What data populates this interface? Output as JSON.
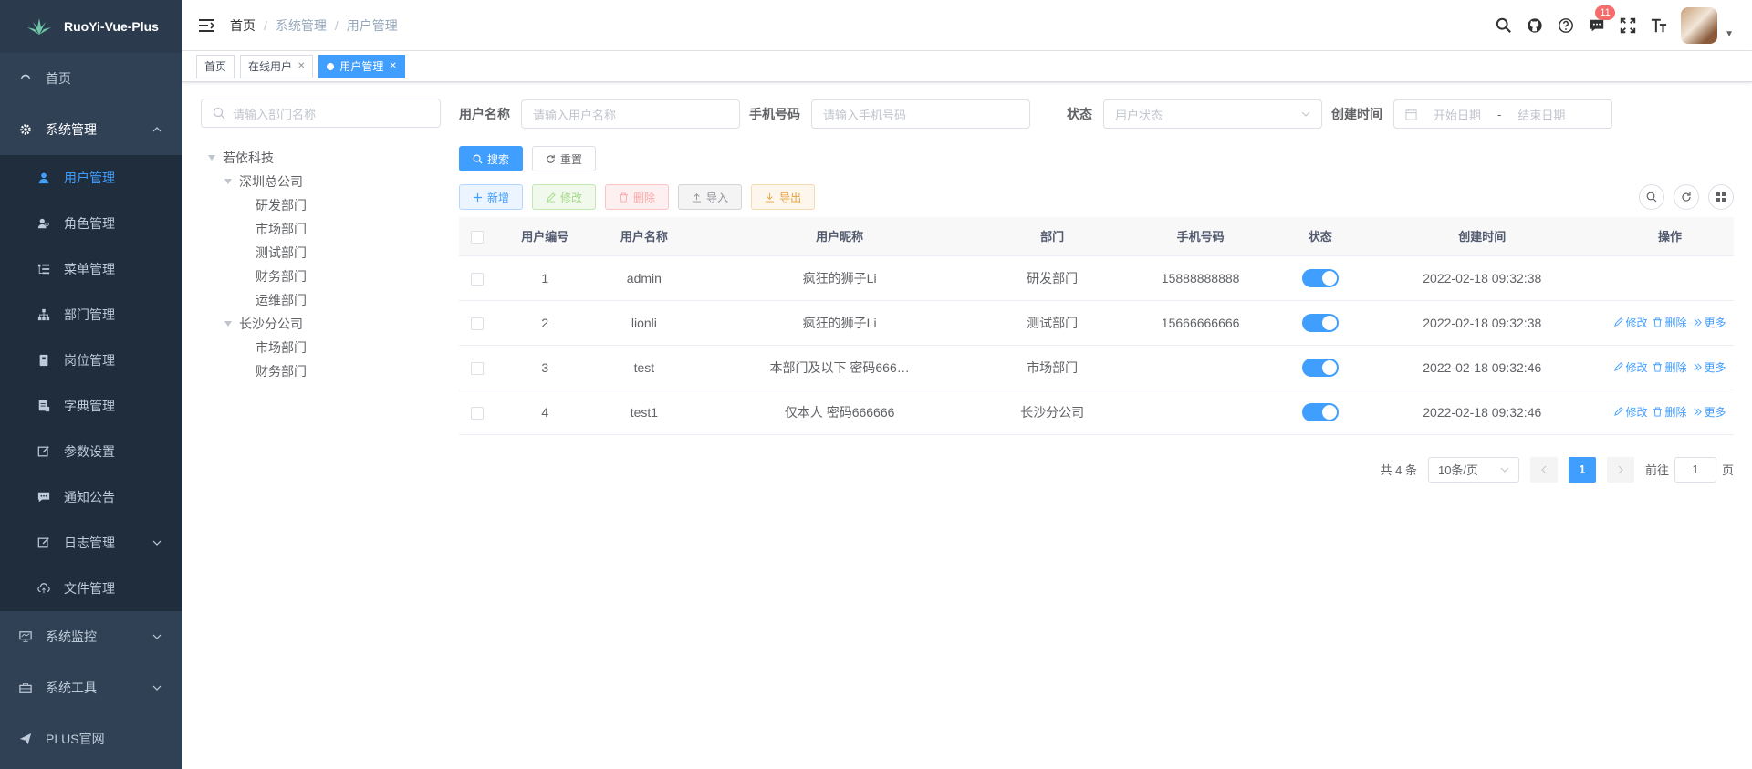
{
  "app": {
    "title": "RuoYi-Vue-Plus",
    "accent": "#409eff",
    "sidebar_bg": "#304156"
  },
  "sidebar": {
    "items": [
      {
        "label": "首页",
        "icon": "dashboard-icon"
      },
      {
        "label": "系统管理",
        "icon": "gear-icon",
        "expanded": true
      },
      {
        "label": "系统监控",
        "icon": "monitor-icon"
      },
      {
        "label": "系统工具",
        "icon": "toolbox-icon"
      },
      {
        "label": "PLUS官网",
        "icon": "send-icon"
      }
    ],
    "sub": [
      {
        "label": "用户管理",
        "icon": "user-icon",
        "active": true
      },
      {
        "label": "角色管理",
        "icon": "role-icon"
      },
      {
        "label": "菜单管理",
        "icon": "tree-table-icon"
      },
      {
        "label": "部门管理",
        "icon": "org-tree-icon"
      },
      {
        "label": "岗位管理",
        "icon": "post-icon"
      },
      {
        "label": "字典管理",
        "icon": "dict-icon"
      },
      {
        "label": "参数设置",
        "icon": "edit-icon"
      },
      {
        "label": "通知公告",
        "icon": "message-icon"
      },
      {
        "label": "日志管理",
        "icon": "log-icon"
      },
      {
        "label": "文件管理",
        "icon": "upload-icon"
      }
    ]
  },
  "navbar": {
    "breadcrumb": [
      "首页",
      "系统管理",
      "用户管理"
    ],
    "notice_count": "11",
    "icons": [
      "search-icon",
      "github-icon",
      "question-icon",
      "message-icon",
      "fullscreen-icon",
      "font-size-icon"
    ]
  },
  "tags": [
    {
      "label": "首页",
      "active": false,
      "closable": false
    },
    {
      "label": "在线用户",
      "active": false,
      "closable": true
    },
    {
      "label": "用户管理",
      "active": true,
      "closable": true
    }
  ],
  "dept_tree": {
    "placeholder": "请输入部门名称",
    "root": "若依科技",
    "branches": [
      {
        "label": "深圳总公司",
        "children": [
          "研发部门",
          "市场部门",
          "测试部门",
          "财务部门",
          "运维部门"
        ]
      },
      {
        "label": "长沙分公司",
        "children": [
          "市场部门",
          "财务部门"
        ]
      }
    ]
  },
  "search_form": {
    "username_label": "用户名称",
    "username_placeholder": "请输入用户名称",
    "phone_label": "手机号码",
    "phone_placeholder": "请输入手机号码",
    "status_label": "状态",
    "status_placeholder": "用户状态",
    "created_label": "创建时间",
    "start_placeholder": "开始日期",
    "range_sep": "-",
    "end_placeholder": "结束日期",
    "search_btn": "搜索",
    "reset_btn": "重置"
  },
  "toolbar": {
    "add": "新增",
    "edit": "修改",
    "delete": "删除",
    "import": "导入",
    "export": "导出"
  },
  "table": {
    "columns": [
      "用户编号",
      "用户名称",
      "用户昵称",
      "部门",
      "手机号码",
      "状态",
      "创建时间",
      "操作"
    ],
    "rows": [
      {
        "id": "1",
        "username": "admin",
        "nickname": "疯狂的狮子Li",
        "dept": "研发部门",
        "phone": "15888888888",
        "status_on": true,
        "created": "2022-02-18 09:32:38",
        "ops": false
      },
      {
        "id": "2",
        "username": "lionli",
        "nickname": "疯狂的狮子Li",
        "dept": "测试部门",
        "phone": "15666666666",
        "status_on": true,
        "created": "2022-02-18 09:32:38",
        "ops": true
      },
      {
        "id": "3",
        "username": "test",
        "nickname": "本部门及以下 密码666…",
        "dept": "市场部门",
        "phone": "",
        "status_on": true,
        "created": "2022-02-18 09:32:46",
        "ops": true
      },
      {
        "id": "4",
        "username": "test1",
        "nickname": "仅本人 密码666666",
        "dept": "长沙分公司",
        "phone": "",
        "status_on": true,
        "created": "2022-02-18 09:32:46",
        "ops": true
      }
    ],
    "op_labels": {
      "edit": "修改",
      "delete": "删除",
      "more": "更多"
    }
  },
  "pagination": {
    "total": "共 4 条",
    "page_size": "10条/页",
    "current": "1",
    "goto_label": "前往",
    "goto_value": "1",
    "page_unit": "页"
  }
}
